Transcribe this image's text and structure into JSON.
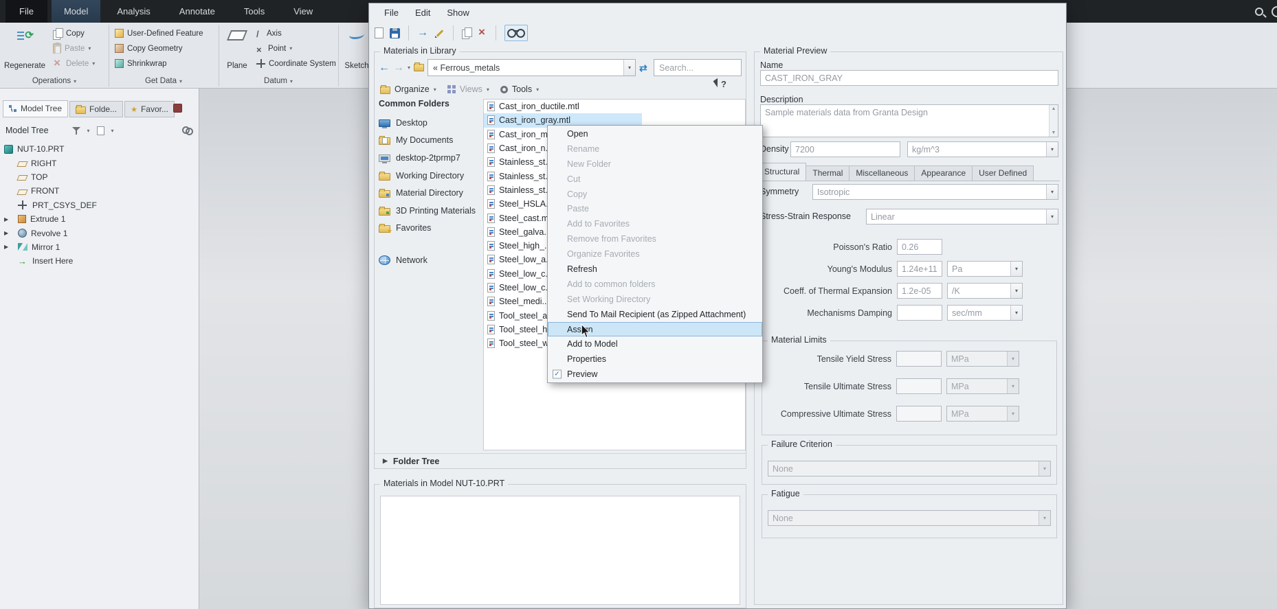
{
  "colors": {
    "accent": "#2f7fc1",
    "selection": "#cde8fb",
    "menu_highlight": "#cde6f7",
    "dark_bar": "#202326"
  },
  "top_bar": {
    "tabs": [
      {
        "label": "File",
        "state": "file-tab"
      },
      {
        "label": "Model",
        "state": "active"
      },
      {
        "label": "Analysis",
        "state": ""
      },
      {
        "label": "Annotate",
        "state": ""
      },
      {
        "label": "Tools",
        "state": ""
      },
      {
        "label": "View",
        "state": ""
      }
    ],
    "right_icon_names": [
      "search-icon",
      "record-icon"
    ]
  },
  "ribbon": {
    "operations": {
      "group_label": "Operations",
      "regenerate": "Regenerate",
      "copy": "Copy",
      "paste": "Paste",
      "delete": "Delete"
    },
    "get_data": {
      "group_label": "Get Data",
      "udf": "User-Defined Feature",
      "copy_geometry": "Copy Geometry",
      "shrinkwrap": "Shrinkwrap"
    },
    "datum": {
      "group_label": "Datum",
      "plane": "Plane",
      "axis": "Axis",
      "point": "Point",
      "csys": "Coordinate System"
    },
    "sketch": "Sketch"
  },
  "model_tree_panel": {
    "tabs": [
      {
        "label": "Model Tree",
        "icon": "tree-tab-icon",
        "state": "active"
      },
      {
        "label": "Folde...",
        "icon": "folder-tab-icon",
        "state": ""
      },
      {
        "label": "Favor...",
        "icon": "star-tab-icon",
        "state": ""
      }
    ],
    "header": "Model Tree",
    "items": [
      {
        "label": "NUT-10.PRT",
        "icon": "part-icon",
        "indent": "root",
        "expand": ""
      },
      {
        "label": "RIGHT",
        "icon": "datum-plane-icon",
        "indent": "child",
        "expand": ""
      },
      {
        "label": "TOP",
        "icon": "datum-plane-icon",
        "indent": "child",
        "expand": ""
      },
      {
        "label": "FRONT",
        "icon": "datum-plane-icon",
        "indent": "child",
        "expand": ""
      },
      {
        "label": "PRT_CSYS_DEF",
        "icon": "csys-icon",
        "indent": "child",
        "expand": ""
      },
      {
        "label": "Extrude 1",
        "icon": "extrude-icon",
        "indent": "child",
        "expand": "expandable"
      },
      {
        "label": "Revolve 1",
        "icon": "revolve-icon",
        "indent": "child",
        "expand": "expandable"
      },
      {
        "label": "Mirror 1",
        "icon": "mirror-icon",
        "indent": "child",
        "expand": "expandable"
      },
      {
        "label": "Insert Here",
        "icon": "insert-icon",
        "indent": "child",
        "expand": ""
      }
    ]
  },
  "dialog": {
    "menu": [
      {
        "label": "File"
      },
      {
        "label": "Edit"
      },
      {
        "label": "Show"
      }
    ],
    "toolbar_icon_names": [
      "new-file-icon",
      "save-icon",
      "assign-arrow-icon",
      "edit-icon",
      "copy-icon",
      "delete-icon",
      "preview-glasses-icon"
    ],
    "library_title": "Materials in Library",
    "nav": {
      "path": "« Ferrous_metals",
      "search_placeholder": "Search..."
    },
    "actions": {
      "organize": "Organize",
      "views": "Views",
      "tools": "Tools"
    },
    "common_folders_title": "Common Folders",
    "common_folders": [
      {
        "label": "Desktop",
        "icon": "desktop-icon",
        "state": ""
      },
      {
        "label": "My Documents",
        "icon": "documents-icon",
        "state": ""
      },
      {
        "label": "desktop-2tprmp7",
        "icon": "computer-icon",
        "state": ""
      },
      {
        "label": "Working Directory",
        "icon": "working-dir-icon",
        "state": ""
      },
      {
        "label": "Material Directory",
        "icon": "material-dir-icon",
        "state": ""
      },
      {
        "label": "3D Printing Materials",
        "icon": "printing-dir-icon",
        "state": ""
      },
      {
        "label": "Favorites",
        "icon": "favorites-icon",
        "state": ""
      },
      {
        "label": "Network",
        "icon": "network-icon",
        "state": "gapped"
      }
    ],
    "files": [
      {
        "label": "Cast_iron_ductile.mtl",
        "state": ""
      },
      {
        "label": "Cast_iron_gray.mtl",
        "state": "selected"
      },
      {
        "label": "Cast_iron_m...",
        "state": ""
      },
      {
        "label": "Cast_iron_n...",
        "state": ""
      },
      {
        "label": "Stainless_st...",
        "state": ""
      },
      {
        "label": "Stainless_st...",
        "state": ""
      },
      {
        "label": "Stainless_st...",
        "state": ""
      },
      {
        "label": "Steel_HSLA...",
        "state": ""
      },
      {
        "label": "Steel_cast.m...",
        "state": ""
      },
      {
        "label": "Steel_galva...",
        "state": ""
      },
      {
        "label": "Steel_high_...",
        "state": ""
      },
      {
        "label": "Steel_low_a...",
        "state": ""
      },
      {
        "label": "Steel_low_c...",
        "state": ""
      },
      {
        "label": "Steel_low_c...",
        "state": ""
      },
      {
        "label": "Steel_medi...",
        "state": ""
      },
      {
        "label": "Tool_steel_a...",
        "state": ""
      },
      {
        "label": "Tool_steel_h...",
        "state": ""
      },
      {
        "label": "Tool_steel_w...",
        "state": ""
      }
    ],
    "folder_tree_label": "Folder Tree",
    "model_section_title": "Materials in Model NUT-10.PRT"
  },
  "context_menu": {
    "items": [
      {
        "label": "Open",
        "state": ""
      },
      {
        "label": "Rename",
        "state": "disabled"
      },
      {
        "label": "New Folder",
        "state": "disabled"
      },
      {
        "label": "Cut",
        "state": "disabled"
      },
      {
        "label": "Copy",
        "state": "disabled"
      },
      {
        "label": "Paste",
        "state": "disabled"
      },
      {
        "label": "Add to Favorites",
        "state": "disabled"
      },
      {
        "label": "Remove from Favorites",
        "state": "disabled"
      },
      {
        "label": "Organize Favorites",
        "state": "disabled"
      },
      {
        "label": "Refresh",
        "state": ""
      },
      {
        "label": "Add to common folders",
        "state": "disabled"
      },
      {
        "label": "Set Working Directory",
        "state": "disabled"
      },
      {
        "label": "Send To Mail Recipient (as Zipped Attachment)",
        "state": ""
      },
      {
        "label": "Assign",
        "state": "highlighted"
      },
      {
        "label": "Add to Model",
        "state": ""
      },
      {
        "label": "Properties",
        "state": ""
      },
      {
        "label": "Preview",
        "state": "checked"
      }
    ]
  },
  "preview": {
    "title": "Material Preview",
    "name_label": "Name",
    "name_value": "CAST_IRON_GRAY",
    "description_label": "Description",
    "description_value": "Sample materials data from Granta Design",
    "density_label": "Density",
    "density_value": "7200",
    "density_unit": "kg/m^3",
    "tabs": [
      {
        "label": "Structural",
        "state": "active"
      },
      {
        "label": "Thermal",
        "state": ""
      },
      {
        "label": "Miscellaneous",
        "state": ""
      },
      {
        "label": "Appearance",
        "state": ""
      },
      {
        "label": "User Defined",
        "state": ""
      }
    ],
    "symmetry_label": "Symmetry",
    "symmetry_value": "Isotropic",
    "stress_strain_label": "Stress-Strain Response",
    "stress_strain_value": "Linear",
    "fields": [
      {
        "label": "Poisson's Ratio",
        "value": "0.26",
        "unit": ""
      },
      {
        "label": "Young's Modulus",
        "value": "1.24e+11",
        "unit": "Pa"
      },
      {
        "label": "Coeff. of Thermal Expansion",
        "value": "1.2e-05",
        "unit": "/K"
      },
      {
        "label": "Mechanisms Damping",
        "value": "",
        "unit": "sec/mm"
      }
    ],
    "material_limits_title": "Material Limits",
    "material_limits": [
      {
        "label": "Tensile Yield Stress",
        "value": "",
        "unit": "MPa"
      },
      {
        "label": "Tensile Ultimate Stress",
        "value": "",
        "unit": "MPa"
      },
      {
        "label": "Compressive Ultimate Stress",
        "value": "",
        "unit": "MPa"
      }
    ],
    "failure_criterion_title": "Failure Criterion",
    "failure_criterion_value": "None",
    "fatigue_title": "Fatigue",
    "fatigue_value": "None"
  }
}
